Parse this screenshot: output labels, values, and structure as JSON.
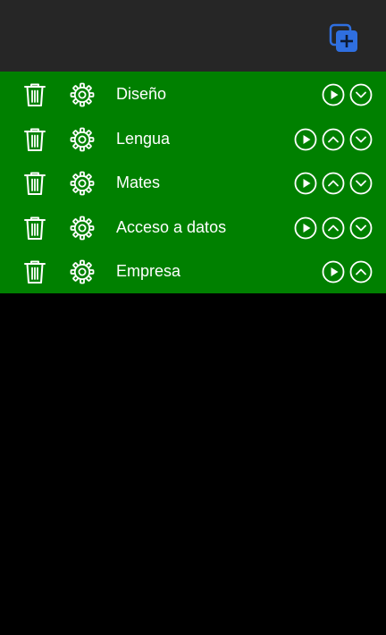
{
  "header": {
    "add_icon": "add-copy-icon",
    "accent_color": "#2f6fe0",
    "background": "#262626"
  },
  "list": {
    "background": "#008000",
    "items": [
      {
        "label": "Diseño",
        "controls": [
          "play",
          "down"
        ]
      },
      {
        "label": "Lengua",
        "controls": [
          "play",
          "up",
          "down"
        ]
      },
      {
        "label": "Mates",
        "controls": [
          "play",
          "up",
          "down"
        ]
      },
      {
        "label": "Acceso a datos",
        "controls": [
          "play",
          "up",
          "down"
        ]
      },
      {
        "label": "Empresa",
        "controls": [
          "play",
          "up"
        ]
      }
    ]
  }
}
